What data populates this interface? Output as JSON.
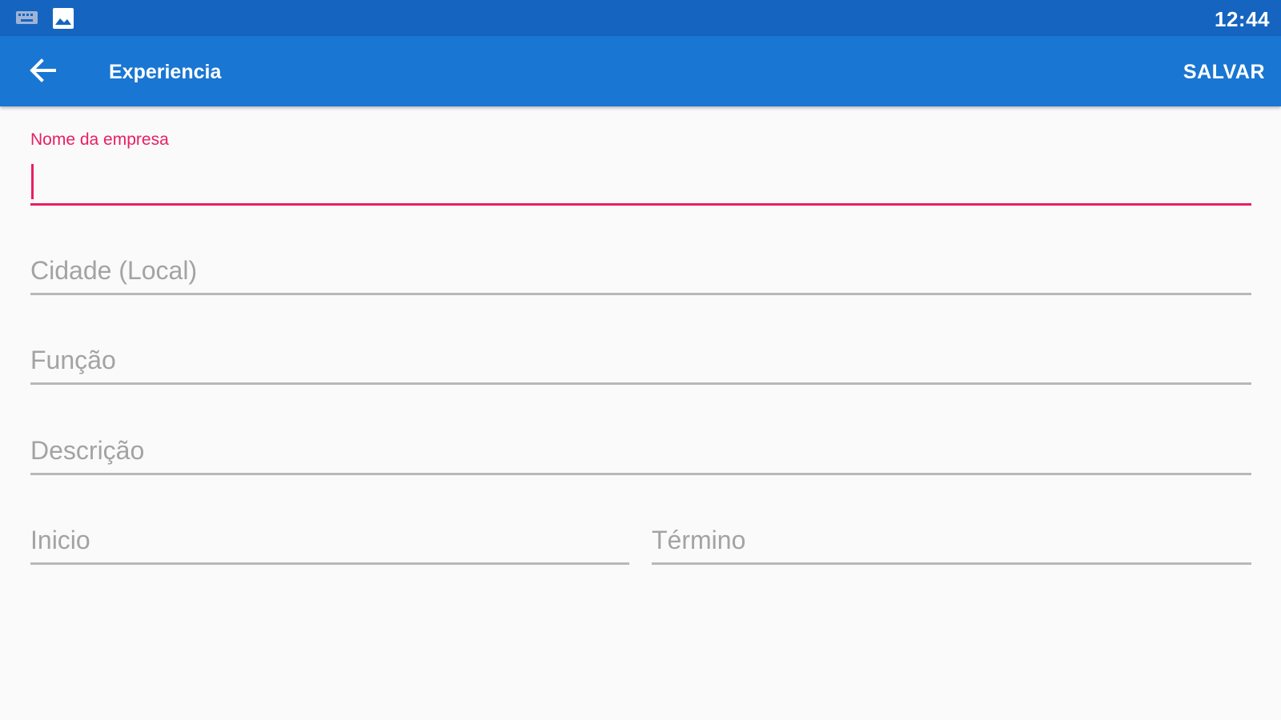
{
  "status_bar": {
    "time": "12:44",
    "icons": [
      "keyboard-icon",
      "image-icon"
    ]
  },
  "app_bar": {
    "title": "Experiencia",
    "back_icon": "arrow-back-icon",
    "save_label": "SALVAR"
  },
  "form": {
    "company_name": {
      "label": "Nome da empresa",
      "value": ""
    },
    "city": {
      "placeholder": "Cidade (Local)",
      "value": ""
    },
    "role": {
      "placeholder": "Função",
      "value": ""
    },
    "description": {
      "placeholder": "Descrição",
      "value": ""
    },
    "start": {
      "placeholder": "Inicio",
      "value": ""
    },
    "end": {
      "placeholder": "Término",
      "value": ""
    }
  },
  "colors": {
    "status_bar": "#1565c0",
    "app_bar": "#1976d2",
    "accent": "#e91e63",
    "hint": "#a3a3a3",
    "underline": "#b8b8b8",
    "background": "#fafafa"
  }
}
